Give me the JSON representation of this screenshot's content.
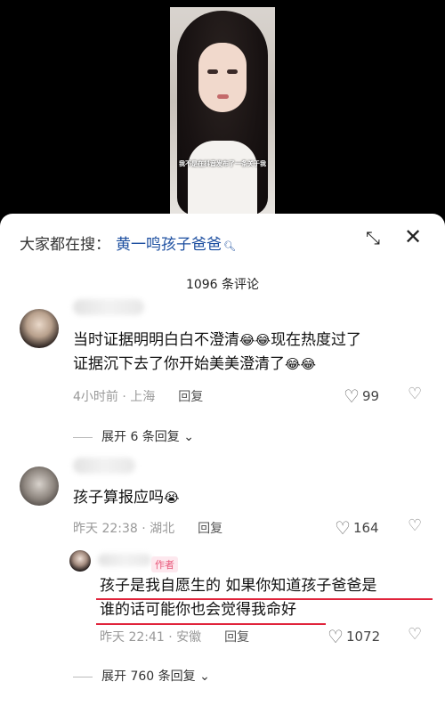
{
  "video": {
    "subtitle": "我不是在抖音发布了一条关于我"
  },
  "search": {
    "prefix": "大家都在搜：",
    "query": "黄一鸣孩子爸爸"
  },
  "comments_count": "1096 条评论",
  "comments": [
    {
      "line1": "当时证据明明白白不澄清",
      "line1b": "现在热度过了",
      "line2": "证据沉下去了你开始美美澄清了",
      "time": "4小时前 · 上海",
      "reply": "回复",
      "likes": "99",
      "expand": "展开 6 条回复"
    },
    {
      "text": "孩子算报应吗",
      "time": "昨天 22:38 · 湖北",
      "reply": "回复",
      "likes": "164"
    }
  ],
  "reply": {
    "tag": "作者",
    "line1": "孩子是我自愿生的 如果你知道孩子爸爸是",
    "line2": "谁的话可能你也会觉得我命好",
    "time": "昨天 22:41 · 安徽",
    "reply": "回复",
    "likes": "1072",
    "expand": "展开 760 条回复"
  },
  "colors": {
    "highlight": "#1d4fa0",
    "underline": "#e0233b"
  }
}
